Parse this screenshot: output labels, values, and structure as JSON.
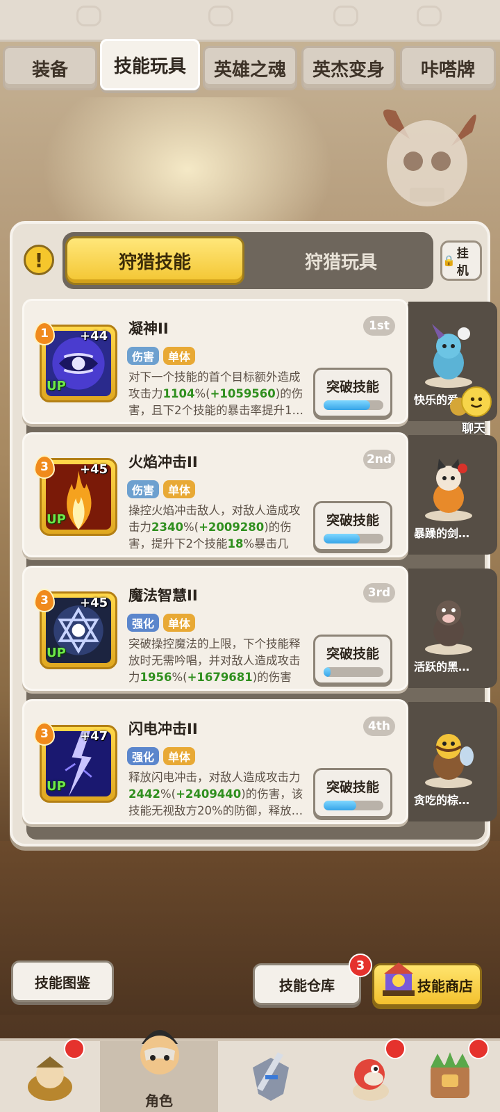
{
  "tabs": [
    {
      "label": "装备"
    },
    {
      "label": "技能玩具"
    },
    {
      "label": "英雄之魂"
    },
    {
      "label": "英杰变身"
    },
    {
      "label": "咔嗒牌"
    }
  ],
  "subtabs": {
    "active": "狩猎技能",
    "inactive": "狩猎玩具"
  },
  "idle_button": {
    "label": "挂机"
  },
  "info_button": {
    "label": "!"
  },
  "skills": [
    {
      "level": "1",
      "plus": "+44",
      "up": "UP",
      "name": "凝神II",
      "rank": "1st",
      "tags": [
        "伤害",
        "单体"
      ],
      "desc_parts": [
        "对下一个技能的首个目标额外造成攻击力",
        "1104",
        "%(",
        "+1059560",
        ")的伤害，且下2个技能的暴击率提升1…"
      ],
      "break_label": "突破技能",
      "progress": 0.78,
      "pet_name": "快乐的爱…"
    },
    {
      "level": "3",
      "plus": "+45",
      "up": "UP",
      "name": "火焰冲击II",
      "rank": "2nd",
      "tags": [
        "伤害",
        "单体"
      ],
      "desc_parts": [
        "操控火焰冲击敌人，对敌人造成攻击力",
        "2340",
        "%(",
        "+2009280",
        ")的伤害，提升下2个技能",
        "18",
        "%暴击几率…"
      ],
      "break_label": "突破技能",
      "progress": 0.6,
      "pet_name": "暴躁的剑…"
    },
    {
      "level": "3",
      "plus": "+45",
      "up": "UP",
      "name": "魔法智慧II",
      "rank": "3rd",
      "tags": [
        "强化",
        "单体"
      ],
      "desc_parts": [
        "突破操控魔法的上限，下个技能释放时无需吟唱，并对敌人造成攻击力",
        "1956",
        "%(",
        "+1679681",
        ")的伤害"
      ],
      "break_label": "突破技能",
      "progress": 0.1,
      "pet_name": "活跃的黑…"
    },
    {
      "level": "3",
      "plus": "+47",
      "up": "UP",
      "name": "闪电冲击II",
      "rank": "4th",
      "tags": [
        "强化",
        "单体"
      ],
      "desc_parts": [
        "释放闪电冲击，对敌人造成攻击力",
        "2442",
        "%(",
        "+2409440",
        ")的伤害，该技能无视敌方20%的防御，释放…"
      ],
      "break_label": "突破技能",
      "progress": 0.55,
      "pet_name": "贪吃的棕…"
    }
  ],
  "chat": {
    "label": "聊天"
  },
  "buttons": {
    "codex": "技能图鉴",
    "storage": "技能仓库",
    "shop": "技能商店",
    "storage_badge": "3"
  },
  "bottom_nav": {
    "active_label": "角色"
  },
  "colors": {
    "accent_yellow": "#f3c531",
    "progress_blue": "#36a4e8",
    "value_green": "#2f8f1e",
    "badge_red": "#e5322d"
  }
}
